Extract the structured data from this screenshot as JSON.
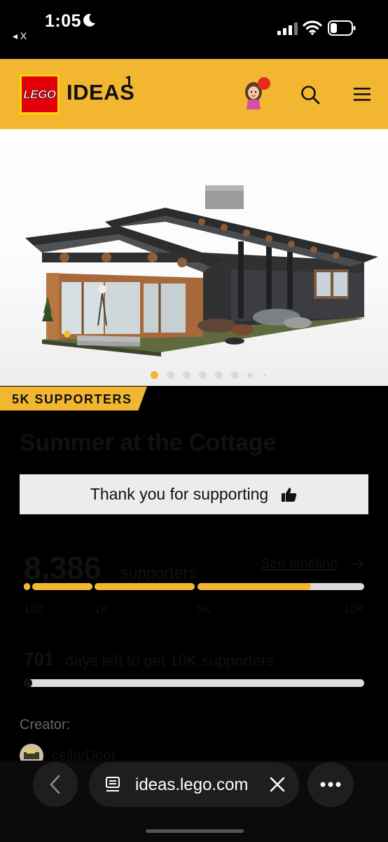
{
  "status_bar": {
    "time": "1:05",
    "back_app": "◂ X",
    "icons": [
      "moon-icon",
      "signal-icon",
      "wifi-icon",
      "battery-icon"
    ]
  },
  "header": {
    "logo_text": "LEGO",
    "ideas_text": "IDEAS",
    "icons": [
      "avatar-icon",
      "search-icon",
      "menu-icon"
    ],
    "brand_color": "#f2b631",
    "logo_color": "#e3000b"
  },
  "hero": {
    "image": "LEGO cottage model render",
    "slide_count": 8,
    "active_slide": 1
  },
  "project": {
    "badge": "5K SUPPORTERS",
    "title": "Summer at the Cottage",
    "support_button": "Thank you for supporting",
    "support_icon": "thumbs-up-icon",
    "supporters_count": "8,386",
    "supporters_label": "supporters",
    "timeline_link": "See timeline",
    "milestones": [
      "100",
      "1K",
      "5K",
      "10K"
    ],
    "progress_fraction_in_5k_to_10k_segment": 0.68,
    "days_left": "701",
    "days_label": "days left to get 10K supporters",
    "creator_label": "Creator:",
    "creator_name": "cellarDoor"
  },
  "browser": {
    "url": "ideas.lego.com",
    "icons": [
      "back-arrow-icon",
      "tabs-icon",
      "close-icon",
      "more-icon"
    ]
  }
}
